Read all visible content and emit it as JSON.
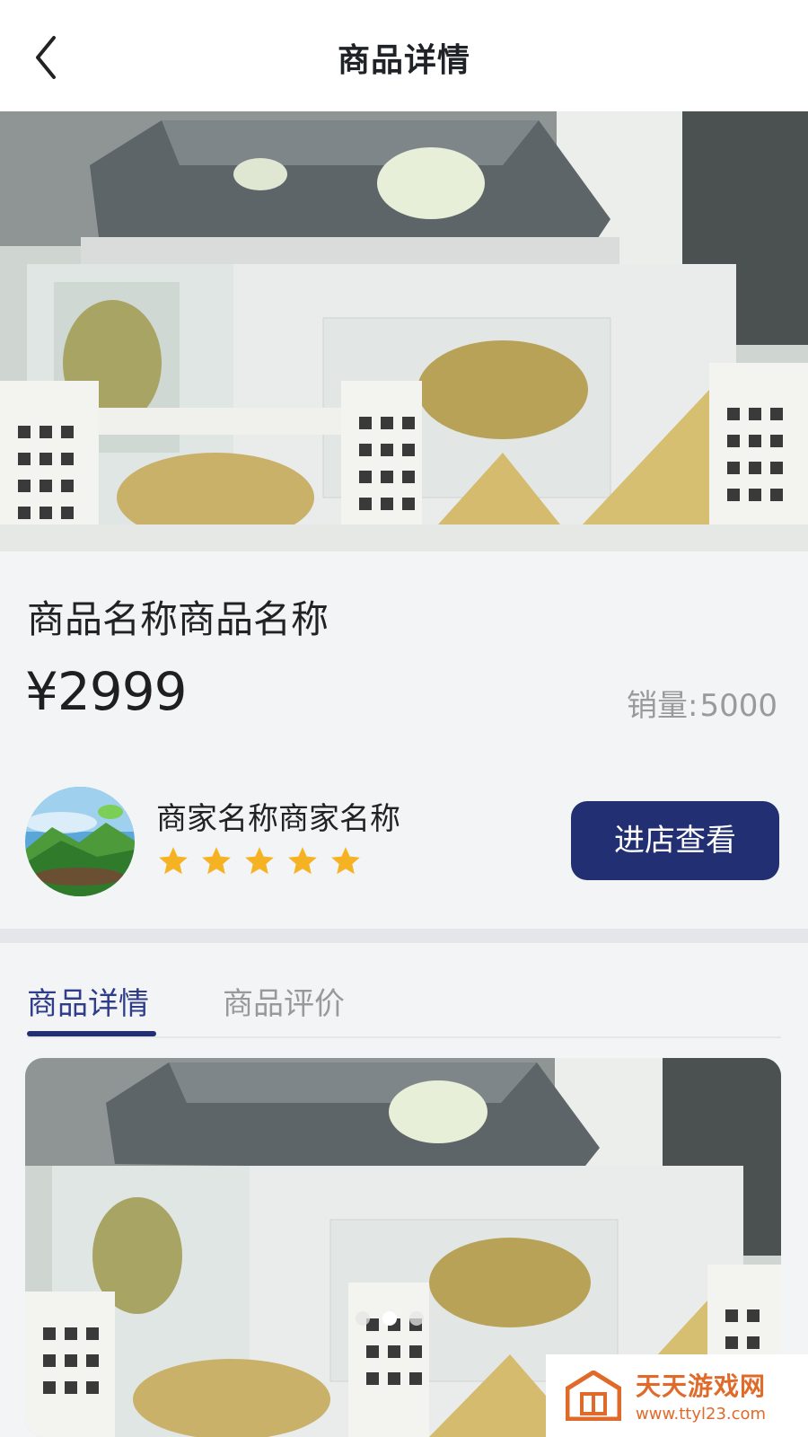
{
  "header": {
    "title": "商品详情",
    "back_icon": "chevron-left-icon"
  },
  "product": {
    "name": "商品名称商品名称",
    "price": "¥2999",
    "sales_label": "销量:",
    "sales_value": "5000"
  },
  "shop": {
    "name": "商家名称商家名称",
    "rating": 5,
    "rating_max": 5,
    "button_label": "进店查看",
    "accent": "#232f73",
    "star_color": "#f5b323"
  },
  "tabs": [
    {
      "label": "商品详情",
      "active": true
    },
    {
      "label": "商品评价",
      "active": false
    }
  ],
  "carousel": {
    "count": 3,
    "active_index": 1
  },
  "watermark": {
    "name": "天天游戏网",
    "url": "www.ttyl23.com"
  }
}
